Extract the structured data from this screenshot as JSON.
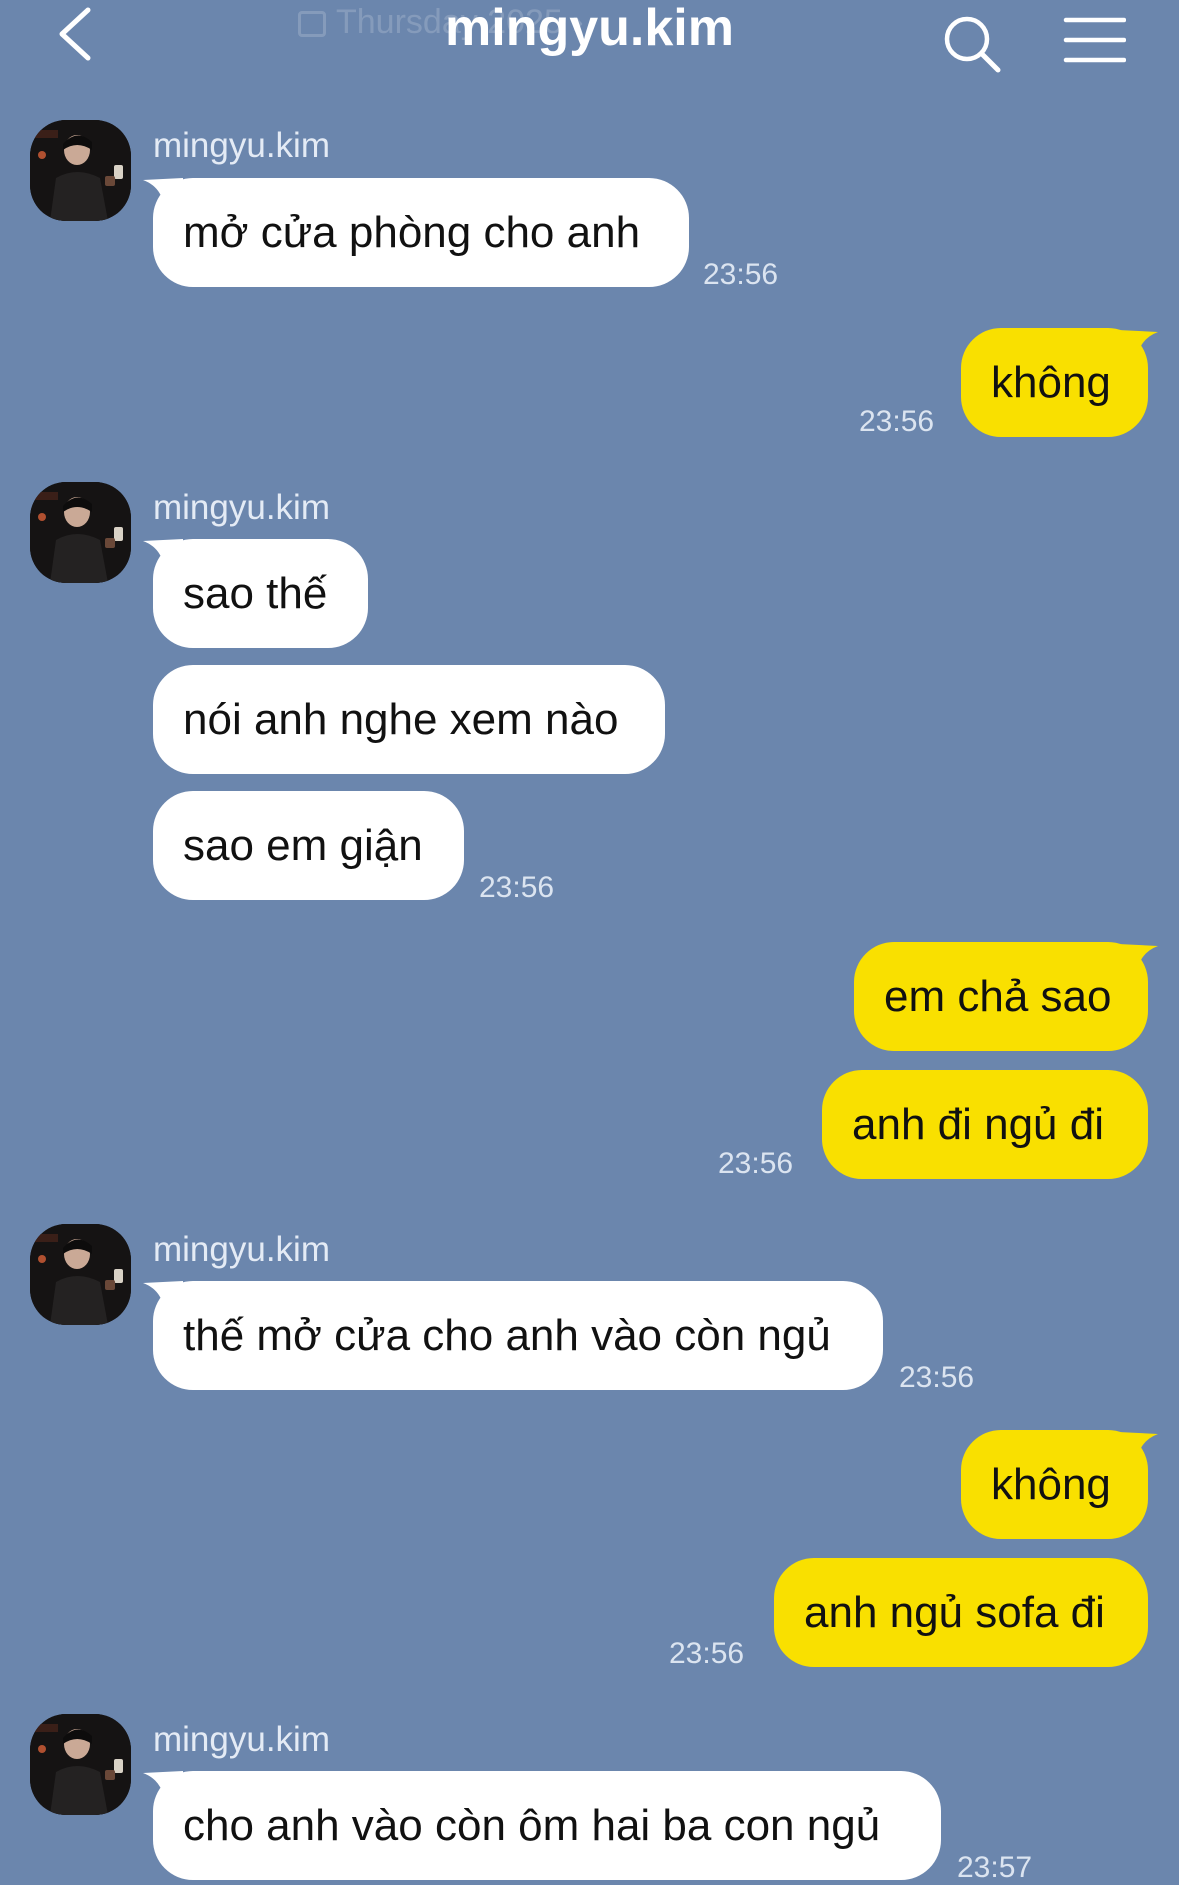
{
  "header": {
    "title": "mingyu.kim",
    "date_text": "Thursday  2025",
    "date_chevron": "›",
    "icons": {
      "back": "chevron-left-icon",
      "search": "search-icon",
      "menu": "hamburger-menu-icon",
      "calendar": "calendar-icon"
    }
  },
  "colors": {
    "background": "#6b86ad",
    "incoming_bubble": "#ffffff",
    "outgoing_bubble": "#f9e000",
    "text": "#111111"
  },
  "messages": [
    {
      "direction": "incoming",
      "sender": "mingyu.kim",
      "text": "mở cửa phòng cho anh",
      "time": "23:56"
    },
    {
      "direction": "outgoing",
      "text": "không",
      "time": "23:56"
    },
    {
      "direction": "incoming",
      "sender": "mingyu.kim",
      "text": "sao thế"
    },
    {
      "direction": "incoming",
      "text": "nói anh nghe xem nào"
    },
    {
      "direction": "incoming",
      "text": "sao em giận",
      "time": "23:56"
    },
    {
      "direction": "outgoing",
      "text": "em chả sao"
    },
    {
      "direction": "outgoing",
      "text": "anh đi ngủ đi",
      "time": "23:56"
    },
    {
      "direction": "incoming",
      "sender": "mingyu.kim",
      "text": "thế mở cửa cho anh vào còn ngủ",
      "time": "23:56"
    },
    {
      "direction": "outgoing",
      "text": "không"
    },
    {
      "direction": "outgoing",
      "text": "anh ngủ sofa đi",
      "time": "23:56"
    },
    {
      "direction": "incoming",
      "sender": "mingyu.kim",
      "text": "cho anh vào còn ôm hai ba con ngủ",
      "time": "23:57"
    }
  ]
}
